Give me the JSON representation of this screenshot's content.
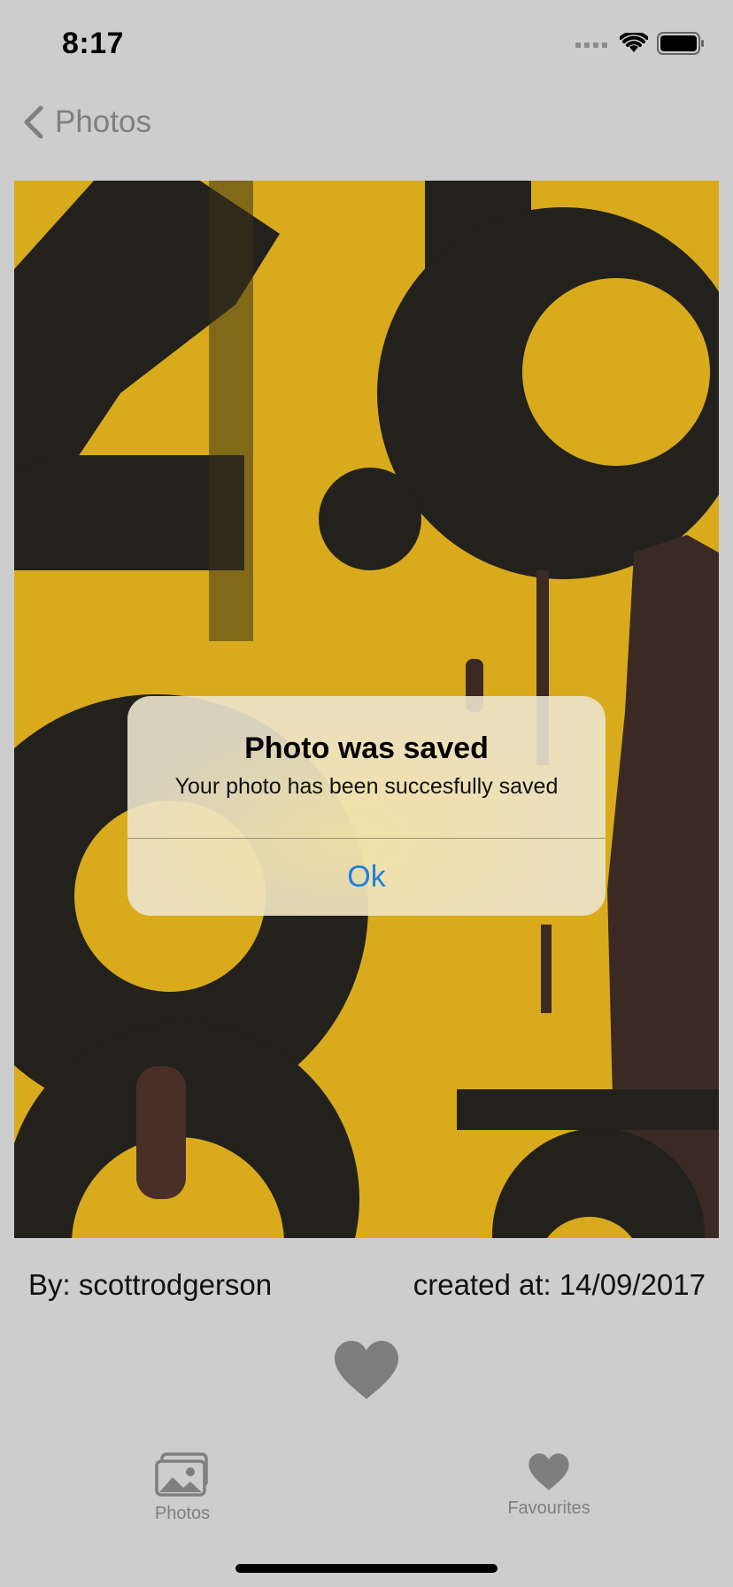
{
  "status_bar": {
    "time": "8:17",
    "icons": [
      "signal-icon",
      "wifi-icon",
      "battery-icon"
    ]
  },
  "nav": {
    "back_label": "Photos",
    "back_icon": "chevron-left-icon"
  },
  "photo": {
    "description_icon": "photo"
  },
  "meta": {
    "author": "By: scottrodgerson",
    "created": "created at: 14/09/2017"
  },
  "like": {
    "icon": "heart-icon"
  },
  "tabbar": {
    "tabs": [
      {
        "label": "Photos",
        "icon": "photos-icon"
      },
      {
        "label": "Favourites",
        "icon": "heart-icon"
      }
    ]
  },
  "alert": {
    "title": "Photo was saved",
    "message": "Your photo has been succesfully saved",
    "ok_label": "Ok"
  },
  "colors": {
    "background": "#cdcdcd",
    "accent": "#1a7fe0",
    "inactive": "#7f7f7f",
    "photo_yellow": "#d9ab1c",
    "photo_dark": "#23211c"
  }
}
